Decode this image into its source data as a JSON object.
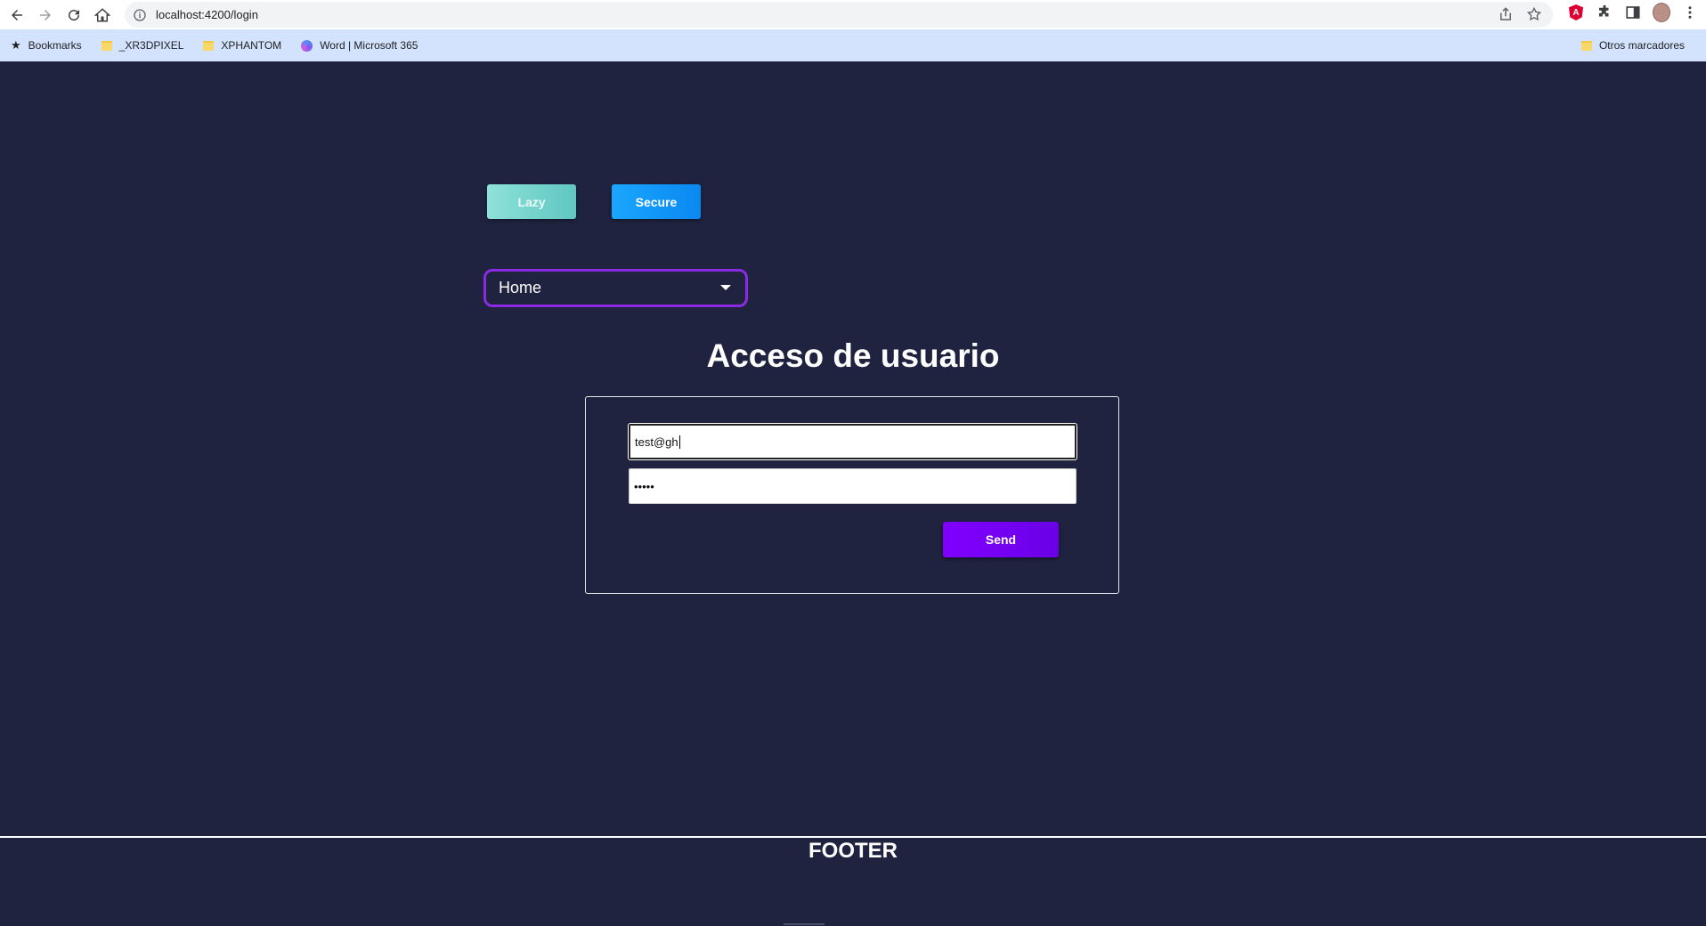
{
  "browser": {
    "url": "localhost:4200/login",
    "bookmarks": [
      {
        "label": "Bookmarks",
        "icon": "star-icon"
      },
      {
        "label": "_XR3DPIXEL",
        "icon": "folder-icon"
      },
      {
        "label": "XPHANTOM",
        "icon": "folder-icon"
      },
      {
        "label": "Word | Microsoft 365",
        "icon": "word-icon"
      }
    ],
    "other_bookmarks": "Otros marcadores"
  },
  "page": {
    "lazy_button": "Lazy",
    "secure_button": "Secure",
    "nav_select": {
      "value": "Home"
    },
    "title": "Acceso de usuario",
    "form": {
      "email_value": "test@gh",
      "password_value": "•••••",
      "send_button": "Send"
    },
    "footer": "FOOTER"
  },
  "colors": {
    "background": "#1f2340",
    "accent": "#8a2be2",
    "send": "#7000f5",
    "secure": "#0a94f7",
    "lazy": "#7ad6ce"
  }
}
